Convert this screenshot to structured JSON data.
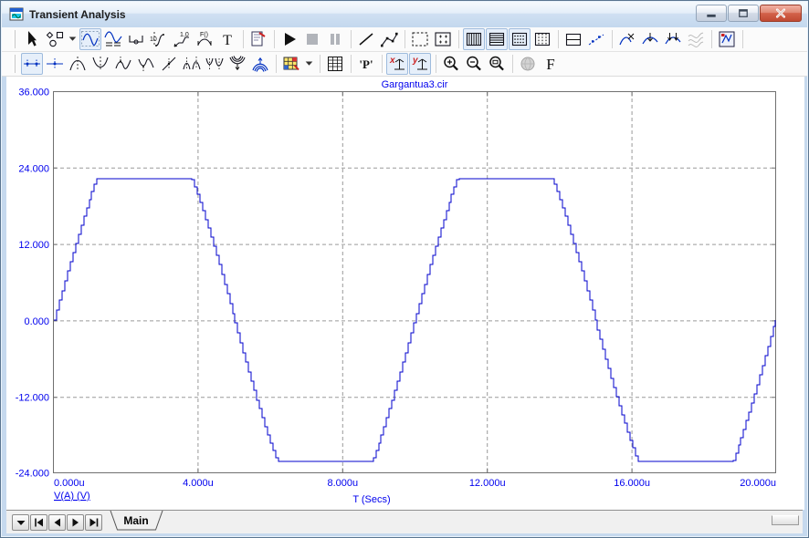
{
  "window": {
    "title": "Transient Analysis",
    "controls": [
      {
        "name": "minimize-button",
        "icon": "minimize-icon"
      },
      {
        "name": "maximize-button",
        "icon": "maximize-icon"
      },
      {
        "name": "close-button",
        "icon": "close-icon"
      }
    ]
  },
  "icons": {
    "text_tool_glyph": "T",
    "formula_glyph": "F()",
    "step_glyph": "1.0",
    "point_glyph": "10",
    "p_measure_glyph": "'P'",
    "font_glyph": "F",
    "x_scale_glyph": "x",
    "y_scale_glyph": "y"
  },
  "toolbar_main": {
    "items": [
      {
        "name": "select-tool-button",
        "icon": "arrow"
      },
      {
        "name": "graphics-tool-button",
        "icon": "shapes"
      },
      {
        "name": "graphics-dropdown-button",
        "icon": "drop",
        "narrow": true
      },
      {
        "name": "scale-mode-button",
        "icon": "scale",
        "state": "checked"
      },
      {
        "name": "cursor-mode-button",
        "icon": "cursorm"
      },
      {
        "name": "point-tag-button",
        "icon": "ptag"
      },
      {
        "name": "horizontal-tag-button",
        "icon": "htag"
      },
      {
        "name": "vertical-tag-button",
        "icon": "vtag"
      },
      {
        "name": "performance-tag-button",
        "icon": "ftag"
      },
      {
        "name": "text-mode-button",
        "icon": "textT"
      },
      {
        "type": "sep"
      },
      {
        "name": "properties-button",
        "icon": "props"
      },
      {
        "type": "sep"
      },
      {
        "name": "run-button",
        "icon": "play"
      },
      {
        "name": "stop-button",
        "icon": "stop",
        "state": "disabled"
      },
      {
        "name": "pause-button",
        "icon": "pause",
        "state": "disabled"
      },
      {
        "type": "sep"
      },
      {
        "name": "line-tool-button",
        "icon": "linet"
      },
      {
        "name": "polyline-tool-button",
        "icon": "poly"
      },
      {
        "type": "sep"
      },
      {
        "name": "select-region-button",
        "icon": "selbox"
      },
      {
        "name": "grid-marks-button",
        "icon": "gridm"
      },
      {
        "type": "sep"
      },
      {
        "name": "vertical-grid-toggle",
        "icon": "gridv",
        "state": "checked"
      },
      {
        "name": "horizontal-grid-toggle",
        "icon": "gridh",
        "state": "checked"
      },
      {
        "name": "dot-grid-toggle",
        "icon": "gridd",
        "state": "checked"
      },
      {
        "name": "minor-grid-toggle",
        "icon": "gridvd"
      },
      {
        "type": "sep"
      },
      {
        "name": "split-plot-button",
        "icon": "splith"
      },
      {
        "name": "tracker-button",
        "icon": "tracker"
      },
      {
        "type": "sep"
      },
      {
        "name": "cursor-x-button",
        "icon": "cursx"
      },
      {
        "name": "cursor-drop-button",
        "icon": "cursd"
      },
      {
        "name": "cursor-both-button",
        "icon": "cursdd"
      },
      {
        "name": "waveform-buffer-button",
        "icon": "wavesg",
        "state": "disabled"
      },
      {
        "type": "sep"
      },
      {
        "name": "plot-properties-button",
        "icon": "plotp"
      },
      {
        "type": "sep"
      }
    ]
  },
  "toolbar_analysis": {
    "items": [
      {
        "name": "tracker-cursor-button",
        "icon": "crossh",
        "state": "checked"
      },
      {
        "name": "tracker-cursor-alt-button",
        "icon": "crossh2"
      },
      {
        "name": "go-to-peak-button",
        "icon": "peak"
      },
      {
        "name": "go-to-valley-button",
        "icon": "valley"
      },
      {
        "name": "go-to-high-button",
        "icon": "high"
      },
      {
        "name": "go-to-low-button",
        "icon": "low"
      },
      {
        "name": "go-to-inflection-button",
        "icon": "slopei"
      },
      {
        "name": "next-peak-button",
        "icon": "peak2"
      },
      {
        "name": "next-valley-button",
        "icon": "valley2"
      },
      {
        "name": "global-low-button",
        "icon": "gmin"
      },
      {
        "name": "global-high-button",
        "icon": "gmax"
      },
      {
        "type": "sep"
      },
      {
        "name": "color-palette-button",
        "icon": "palette"
      },
      {
        "name": "palette-dropdown-button",
        "icon": "drop",
        "narrow": true
      },
      {
        "type": "sep"
      },
      {
        "name": "numeric-output-button",
        "icon": "tablei"
      },
      {
        "type": "sep"
      },
      {
        "name": "periodic-measure-button",
        "icon": "pq"
      },
      {
        "type": "sep"
      },
      {
        "name": "x-scale-lock-button",
        "icon": "xsc",
        "state": "checked"
      },
      {
        "name": "y-scale-lock-button",
        "icon": "ysc",
        "state": "checked"
      },
      {
        "type": "sep"
      },
      {
        "name": "zoom-in-button",
        "icon": "zin"
      },
      {
        "name": "zoom-out-button",
        "icon": "zout"
      },
      {
        "name": "zoom-region-button",
        "icon": "zwin"
      },
      {
        "type": "sep"
      },
      {
        "name": "web-button",
        "icon": "sphere",
        "state": "disabled"
      },
      {
        "name": "font-button",
        "icon": "fontF"
      }
    ]
  },
  "chart_data": {
    "type": "line",
    "title": "Gargantua3.cir",
    "xlabel": "T (Secs)",
    "trace_label": "V(A) (V)",
    "xlim_us": [
      0,
      20
    ],
    "ylim": [
      -24,
      36
    ],
    "x_ticks": [
      "0.000u",
      "4.000u",
      "8.000u",
      "12.000u",
      "16.000u",
      "20.000u"
    ],
    "y_ticks": [
      "36.000",
      "24.000",
      "12.000",
      "0.000",
      "-12.000",
      "-24.000"
    ],
    "grid": "dashed",
    "series": [
      {
        "name": "V(A)",
        "color": "#0000cd",
        "waveform": "clipped-sine",
        "amplitude": 33,
        "clip_high": 22.3,
        "clip_low": -22.3,
        "period_us": 10,
        "t_start_us": 0,
        "t_end_us": 20,
        "sample_step_us": 0.075,
        "key_points_us_v": [
          [
            0,
            0
          ],
          [
            1.2,
            22.3
          ],
          [
            3.8,
            22.3
          ],
          [
            5,
            0
          ],
          [
            6.2,
            -22.3
          ],
          [
            8.8,
            -22.3
          ],
          [
            10,
            0
          ],
          [
            11.2,
            22.3
          ],
          [
            13.8,
            22.3
          ],
          [
            15,
            0
          ],
          [
            16.2,
            -22.3
          ],
          [
            18.8,
            -22.3
          ],
          [
            20,
            0
          ]
        ]
      }
    ]
  },
  "bottom_bar": {
    "tab_main": "Main",
    "nav": [
      {
        "name": "page-list-button",
        "icon": "navdrop"
      },
      {
        "name": "first-page-button",
        "icon": "navfirst"
      },
      {
        "name": "prev-page-button",
        "icon": "navprev"
      },
      {
        "name": "next-page-button",
        "icon": "navnext"
      },
      {
        "name": "last-page-button",
        "icon": "navlast"
      }
    ]
  },
  "colors": {
    "trace": "#0000cd",
    "axis_text": "#0000ee",
    "grid": "#9a9a9a",
    "frame": "#707070",
    "titlebar_border": "#5a7590",
    "close_button": "#c14a33"
  }
}
